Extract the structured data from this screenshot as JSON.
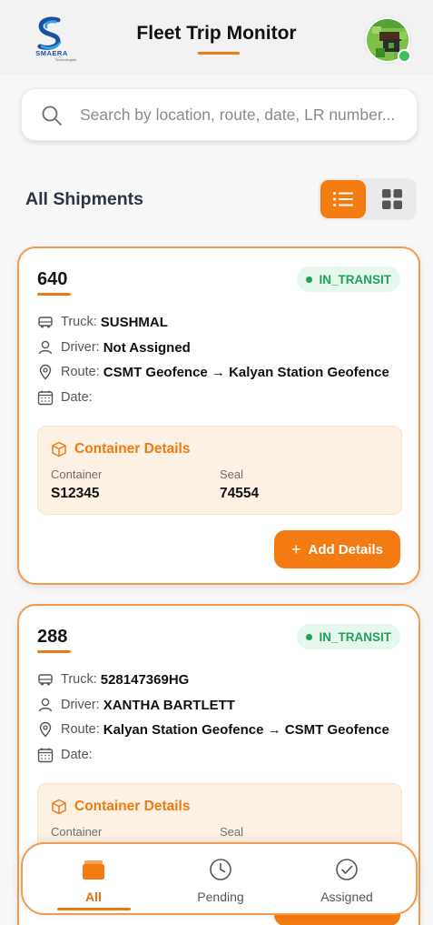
{
  "header": {
    "title": "Fleet Trip Monitor",
    "logo_text": "SMAERA",
    "logo_subtext": "Technologies",
    "online_status_color": "#3cbf5c"
  },
  "search": {
    "placeholder": "Search by location, route, date, LR number...",
    "value": "",
    "icon": "search-icon"
  },
  "section": {
    "title": "All Shipments",
    "view_mode": "list"
  },
  "labels": {
    "truck": "Truck:",
    "driver": "Driver:",
    "route": "Route:",
    "date": "Date:",
    "container_details": "Container Details",
    "container": "Container",
    "seal": "Seal",
    "add_details": "Add Details"
  },
  "trips": [
    {
      "id": "640",
      "status": "IN_TRANSIT",
      "truck": "SUSHMAL",
      "driver": "Not Assigned",
      "route": "CSMT Geofence → Kalyan Station Geofence",
      "date": "",
      "container": "S12345",
      "seal": "74554"
    },
    {
      "id": "288",
      "status": "IN_TRANSIT",
      "truck": "528147369HG",
      "driver": "XANTHA BARTLETT",
      "route": "Kalyan Station Geofence → CSMT Geofence",
      "date": "",
      "container": "",
      "seal": ""
    }
  ],
  "bottom_nav": {
    "items": [
      {
        "label": "All",
        "icon": "folder-icon",
        "active": true
      },
      {
        "label": "Pending",
        "icon": "clock-icon",
        "active": false
      },
      {
        "label": "Assigned",
        "icon": "check-circle-icon",
        "active": false
      }
    ]
  },
  "colors": {
    "accent": "#f47a12",
    "status_green": "#1fa257",
    "card_border": "#f39a4c",
    "container_bg": "#fdf1e3"
  }
}
